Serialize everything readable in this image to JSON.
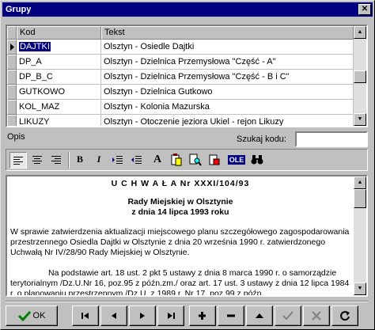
{
  "window": {
    "title": "Grupy",
    "close_label": "✕"
  },
  "grid": {
    "columns": [
      "Kod",
      "Tekst"
    ],
    "rows": [
      {
        "kod": "DAJTKI",
        "tekst": "Olsztyn - Osiedle Dajtki"
      },
      {
        "kod": "DP_A",
        "tekst": "Olsztyn - Dzielnica Przemysłowa \"Część - A\""
      },
      {
        "kod": "DP_B_C",
        "tekst": "Olsztyn - Dzielnica Przemysłowa \"Część - B i C\""
      },
      {
        "kod": "GUTKOWO",
        "tekst": "Olsztyn - Dzielnica Gutkowo"
      },
      {
        "kod": "KOL_MAZ",
        "tekst": "Olsztyn - Kolonia Mazurska"
      },
      {
        "kod": "LIKUZY",
        "tekst": "Olsztyn - Otoczenie jeziora Ukiel - rejon Likuzy"
      }
    ]
  },
  "opis_label": "Opis",
  "search": {
    "label": "Szukaj kodu:",
    "value": ""
  },
  "toolbar": {
    "bold": "B",
    "italic": "I",
    "font": "A",
    "ole": "OLE"
  },
  "memo": {
    "heading1": "U C H W A Ł A   Nr XXXI/104/93",
    "heading2": "Rady Miejskiej w Olsztynie",
    "heading3": "z dnia 14 lipca 1993 roku",
    "para1": "W sprawie zatwierdzenia aktualizacji miejscowego planu szczegółowego zagospodarowania przestrzennego Osiedla Dajtki w Olsztynie z dnia 20 września 1990 r. zatwierdzonego Uchwałą Nr IV/28/90 Rady Miejskiej w Olsztynie.",
    "para2": "Na podstawie art. 18 ust. 2 pkt 5 ustawy z dnia 8 marca 1990 r. o samorządzie terytorialnym /Dz.U.Nr 16, poz.95 z późn.zm./ oraz art. 17 ust. 3 ustawy z dnia 12 lipca 1984 r. o planowaniu przestrzennym /Dz.U. z 1989 r. Nr 17, poz.99 z późn."
  },
  "buttons": {
    "ok": "OK"
  },
  "colors": {
    "selection": "#000080",
    "face": "#c0c0c0"
  }
}
